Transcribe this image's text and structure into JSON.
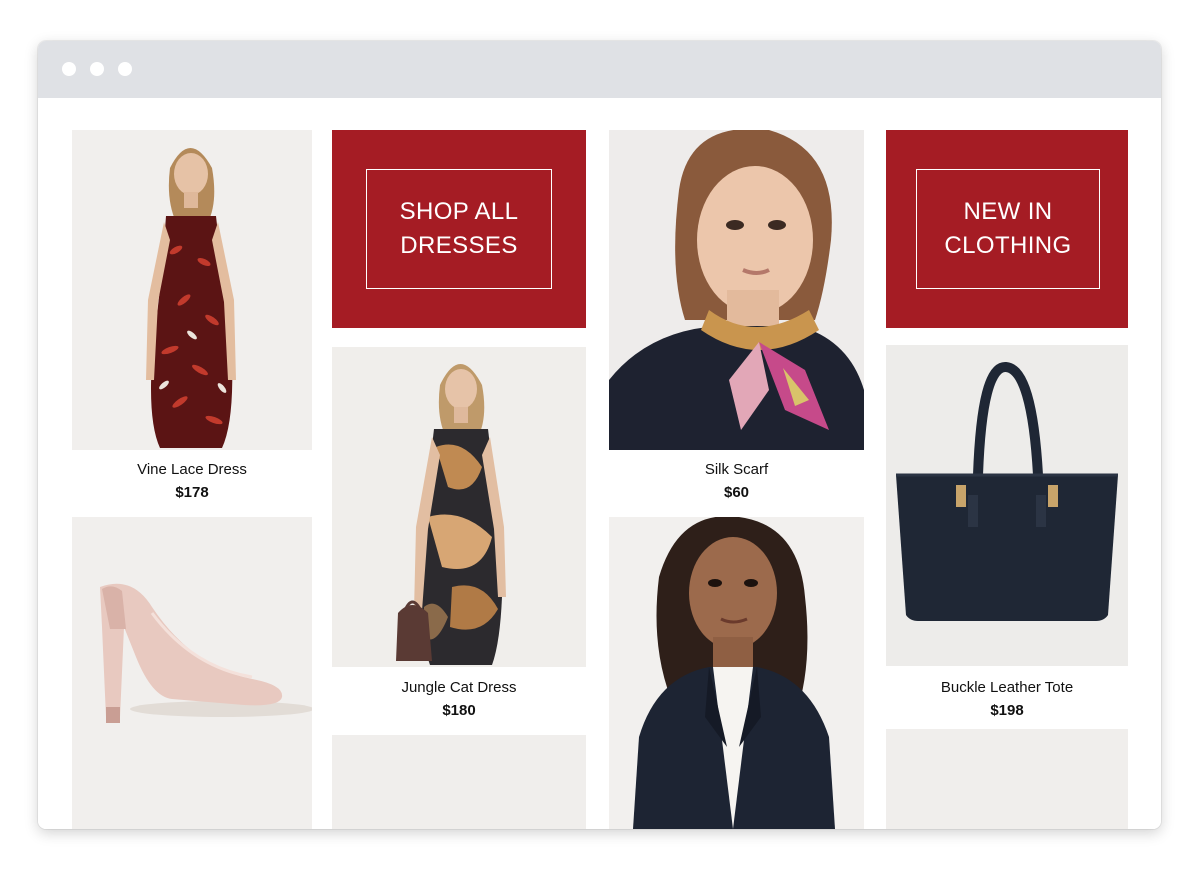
{
  "browser": {
    "window_controls": [
      "dot",
      "dot",
      "dot"
    ]
  },
  "promos": {
    "shop_all_dresses": "SHOP ALL\nDRESSES",
    "new_in_clothing": "NEW IN\nCLOTHING"
  },
  "products": [
    {
      "name": "Vine Lace Dress",
      "price": "$178"
    },
    {
      "name": "Jungle Cat Dress",
      "price": "$180"
    },
    {
      "name": "Silk Scarf",
      "price": "$60"
    },
    {
      "name": "Buckle Leather Tote",
      "price": "$198"
    }
  ],
  "colors": {
    "accent": "#a51c24",
    "tile_background": "#f0eeec",
    "titlebar": "#dfe1e5"
  }
}
